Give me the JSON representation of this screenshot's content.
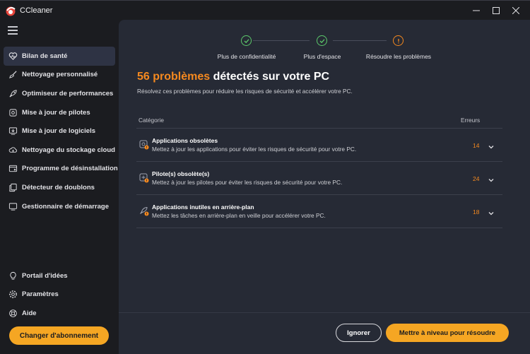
{
  "window": {
    "title": "CCleaner"
  },
  "sidebar": {
    "items": [
      {
        "label": "Bilan de santé",
        "icon": "heart-icon",
        "active": true
      },
      {
        "label": "Nettoyage personnalisé",
        "icon": "broom-icon"
      },
      {
        "label": "Optimiseur de performances",
        "icon": "rocket-icon"
      },
      {
        "label": "Mise à jour de pilotes",
        "icon": "driver-gear-icon"
      },
      {
        "label": "Mise à jour de logiciels",
        "icon": "software-update-icon"
      },
      {
        "label": "Nettoyage du stockage cloud",
        "icon": "cloud-icon"
      },
      {
        "label": "Programme de désinstallation",
        "icon": "uninstall-icon"
      },
      {
        "label": "Détecteur de doublons",
        "icon": "duplicate-icon"
      },
      {
        "label": "Gestionnaire de démarrage",
        "icon": "monitor-icon"
      }
    ],
    "bottom_items": [
      {
        "label": "Portail d'idées",
        "icon": "lightbulb-icon"
      },
      {
        "label": "Paramètres",
        "icon": "gear-icon"
      },
      {
        "label": "Aide",
        "icon": "help-icon"
      }
    ],
    "upgrade_label": "Changer d'abonnement"
  },
  "stepper": {
    "steps": [
      {
        "label": "Plus de confidentialité",
        "status": "done"
      },
      {
        "label": "Plus d'espace",
        "status": "done"
      },
      {
        "label": "Résoudre les problèmes",
        "status": "warning"
      }
    ]
  },
  "main": {
    "count_text": "56 problèmes",
    "headline_rest": " détectés sur votre PC",
    "subline": "Résolvez ces problèmes pour réduire les risques de sécurité et accélérer votre PC.",
    "table": {
      "col_category": "Catégorie",
      "col_errors": "Erreurs",
      "rows": [
        {
          "title": "Applications obsolètes",
          "desc": "Mettez à jour les applications pour éviter les risques de sécurité pour votre PC.",
          "count": "14",
          "icon": "outdated-app-icon"
        },
        {
          "title": "Pilote(s) obsolète(s)",
          "desc": "Mettez à jour les pilotes pour éviter les risques de sécurité pour votre PC.",
          "count": "24",
          "icon": "outdated-driver-icon"
        },
        {
          "title": "Applications inutiles en arrière-plan",
          "desc": "Mettez les tâches en arrière-plan en veille pour accélérer votre PC.",
          "count": "18",
          "icon": "background-apps-icon"
        }
      ]
    },
    "ignore_label": "Ignorer",
    "upgrade_fix_label": "Mettre à niveau pour résoudre"
  },
  "colors": {
    "accent": "#f5a623",
    "warning": "#f5891f",
    "success": "#5cc96b",
    "panel": "#262a35",
    "sidebar": "#1b1c20"
  }
}
